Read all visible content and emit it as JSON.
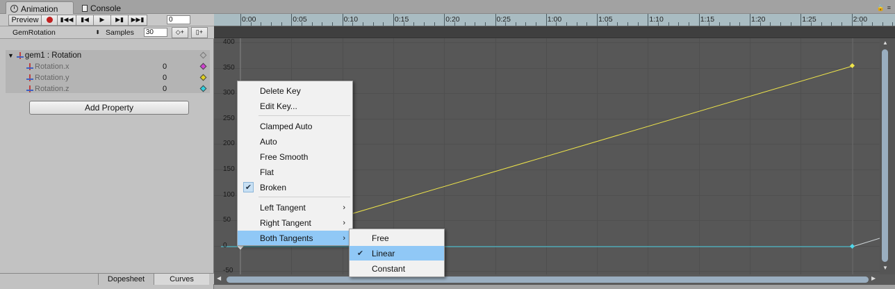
{
  "tabs": [
    {
      "label": "Animation"
    },
    {
      "label": "Console"
    }
  ],
  "toolbar": {
    "preview_label": "Preview",
    "frame_value": "0"
  },
  "clip": {
    "name": "GemRotation",
    "samples_label": "Samples",
    "samples_value": "30"
  },
  "properties": {
    "group": "gem1 : Rotation",
    "items": [
      {
        "label": "Rotation.x",
        "value": "0",
        "color": "#d040d0"
      },
      {
        "label": "Rotation.y",
        "value": "0",
        "color": "#e0d020"
      },
      {
        "label": "Rotation.z",
        "value": "0",
        "color": "#30d0e0"
      }
    ]
  },
  "add_property_label": "Add Property",
  "bottom_tabs": {
    "dopesheet": "Dopesheet",
    "curves": "Curves"
  },
  "timeline": {
    "labels": [
      "0:00",
      "0:05",
      "0:10",
      "0:15",
      "0:20",
      "0:25",
      "1:00",
      "1:05",
      "1:10",
      "1:15",
      "1:20",
      "1:25",
      "2:00"
    ]
  },
  "y_axis": {
    "labels": [
      "400",
      "350",
      "300",
      "250",
      "200",
      "150",
      "100",
      "50",
      "0",
      "-50"
    ]
  },
  "context_menu": {
    "items": [
      {
        "label": "Delete Key"
      },
      {
        "label": "Edit Key..."
      },
      {
        "label": "Clamped Auto"
      },
      {
        "label": "Auto"
      },
      {
        "label": "Free Smooth"
      },
      {
        "label": "Flat"
      },
      {
        "label": "Broken",
        "checked": true
      },
      {
        "label": "Left Tangent"
      },
      {
        "label": "Right Tangent"
      },
      {
        "label": "Both Tangents",
        "highlighted": true
      }
    ]
  },
  "submenu": {
    "items": [
      {
        "label": "Free"
      },
      {
        "label": "Linear",
        "checked": true,
        "highlighted": true
      },
      {
        "label": "Constant"
      }
    ]
  },
  "colors": {
    "curve_yellow": "#f0e64a",
    "curve_cyan": "#4fd7ea",
    "menu_highlight": "#90c8f6",
    "ruler": "#a9bcc2"
  }
}
